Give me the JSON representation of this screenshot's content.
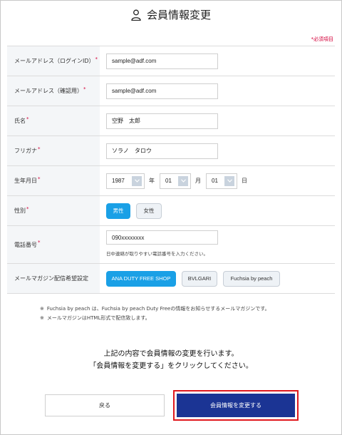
{
  "page": {
    "title": "会員情報変更",
    "required_note": "*必須項目"
  },
  "form": {
    "email": {
      "label": "メールアドレス（ログインID）",
      "required": "*",
      "value": "sample@adf.com"
    },
    "email_confirm": {
      "label": "メールアドレス（確認用）",
      "required": "*",
      "value": "sample@adf.com"
    },
    "name": {
      "label": "氏名",
      "required": "*",
      "value": "空野　太郎"
    },
    "furigana": {
      "label": "フリガナ",
      "required": "*",
      "value": "ソラノ　タロウ"
    },
    "birthdate": {
      "label": "生年月日",
      "required": "*",
      "year": "1987",
      "year_unit": "年",
      "month": "01",
      "month_unit": "月",
      "day": "01",
      "day_unit": "日"
    },
    "gender": {
      "label": "性別",
      "required": "*",
      "options": [
        {
          "label": "男性",
          "selected": true
        },
        {
          "label": "女性",
          "selected": false
        }
      ]
    },
    "phone": {
      "label": "電話番号",
      "required": "*",
      "value": "090xxxxxxxx",
      "hint": "日中連絡が取りやすい電話番号を入力ください。"
    },
    "newsletter": {
      "label": "メールマガジン配信希望設定",
      "options": [
        {
          "label": "ANA DUTY FREE SHOP",
          "selected": true
        },
        {
          "label": "BVLGARI",
          "selected": false
        },
        {
          "label": "Fuchsia by peach",
          "selected": false
        }
      ]
    }
  },
  "notes": {
    "bullet": "※",
    "line1": "Fuchsia by peach は、Fuchsia by peach Duty Freeの情報をお知らせするメールマガジンです。",
    "line2": "メールマガジンはHTML形式で配信致します。"
  },
  "message": {
    "line1": "上記の内容で会員情報の変更を行います。",
    "line2": "「会員情報を変更する」をクリックしてください。"
  },
  "buttons": {
    "back": "戻る",
    "submit": "会員情報を変更する"
  },
  "colors": {
    "required": "#d4003a",
    "accent": "#1aa0e6",
    "primary_button": "#1b3494",
    "highlight_border": "#e0191e"
  },
  "icons": {
    "title_icon": "user-icon",
    "select_arrow": "chevron-down-icon"
  }
}
